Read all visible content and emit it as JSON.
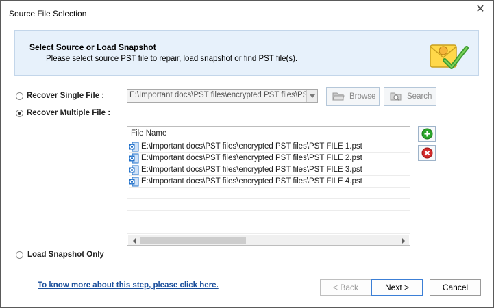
{
  "window": {
    "title": "Source File Selection",
    "close_glyph": "✕"
  },
  "header": {
    "title": "Select Source or Load Snapshot",
    "subtitle": "Please select source PST file to repair, load snapshot or find PST file(s)."
  },
  "options": {
    "single_label": "Recover Single File :",
    "single_checked": false,
    "multiple_label": "Recover Multiple File :",
    "multiple_checked": true,
    "snapshot_label": "Load Snapshot Only",
    "snapshot_checked": false
  },
  "single_file": {
    "path_value": "E:\\Important docs\\PST files\\encrypted PST files\\PST",
    "browse_label": "Browse",
    "search_label": "Search"
  },
  "file_list": {
    "column_header": "File Name",
    "rows": [
      "E:\\Important docs\\PST files\\encrypted PST files\\PST FILE 1.pst",
      "E:\\Important docs\\PST files\\encrypted PST files\\PST FILE 2.pst",
      "E:\\Important docs\\PST files\\encrypted PST files\\PST FILE 3.pst",
      "E:\\Important docs\\PST files\\encrypted PST files\\PST FILE 4.pst"
    ]
  },
  "footer": {
    "help_link": "To know more about this step, please click here.",
    "back_label": "< Back",
    "next_label": "Next >",
    "cancel_label": "Cancel"
  },
  "icons": {
    "add": "plus-circle-icon",
    "remove": "x-circle-icon",
    "pst": "outlook-pst-icon",
    "browse": "folder-open-icon",
    "search": "search-folder-icon",
    "header": "mail-check-icon"
  },
  "colors": {
    "header_bg": "#e7f1fb",
    "add_green": "#2aa52a",
    "remove_red": "#d22a2a",
    "link_blue": "#1b4f9c",
    "pst_blue": "#1e6fc9"
  }
}
